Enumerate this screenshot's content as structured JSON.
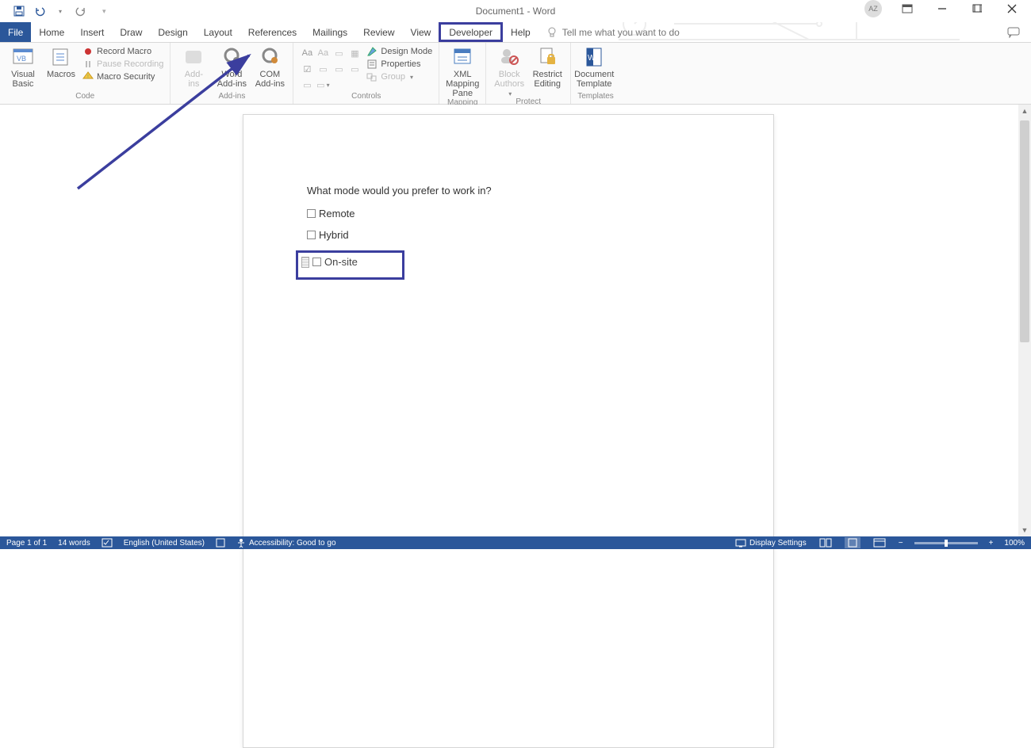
{
  "title": "Document1 - Word",
  "user_initials": "AZ",
  "tellme_placeholder": "Tell me what you want to do",
  "tabs": {
    "file": "File",
    "home": "Home",
    "insert": "Insert",
    "draw": "Draw",
    "design": "Design",
    "layout": "Layout",
    "references": "References",
    "mailings": "Mailings",
    "review": "Review",
    "view": "View",
    "developer": "Developer",
    "help": "Help"
  },
  "ribbon": {
    "code": {
      "label": "Code",
      "visual_basic": "Visual\nBasic",
      "macros": "Macros",
      "record_macro": "Record Macro",
      "pause_recording": "Pause Recording",
      "macro_security": "Macro Security"
    },
    "addins": {
      "label": "Add-ins",
      "addins": "Add-\nins",
      "word_addins": "Word\nAdd-ins",
      "com_addins": "COM\nAdd-ins"
    },
    "controls": {
      "label": "Controls",
      "design_mode": "Design Mode",
      "properties": "Properties",
      "group": "Group"
    },
    "mapping": {
      "label": "Mapping",
      "xml_pane": "XML Mapping\nPane"
    },
    "protect": {
      "label": "Protect",
      "block_authors": "Block\nAuthors",
      "restrict_editing": "Restrict\nEditing"
    },
    "templates": {
      "label": "Templates",
      "doc_template": "Document\nTemplate"
    }
  },
  "document": {
    "question": "What mode would you prefer to work in?",
    "opt1": "Remote",
    "opt2": "Hybrid",
    "opt3": "On-site"
  },
  "status": {
    "page": "Page 1 of 1",
    "words": "14 words",
    "language": "English (United States)",
    "accessibility": "Accessibility: Good to go",
    "display_settings": "Display Settings",
    "zoom": "100%"
  }
}
